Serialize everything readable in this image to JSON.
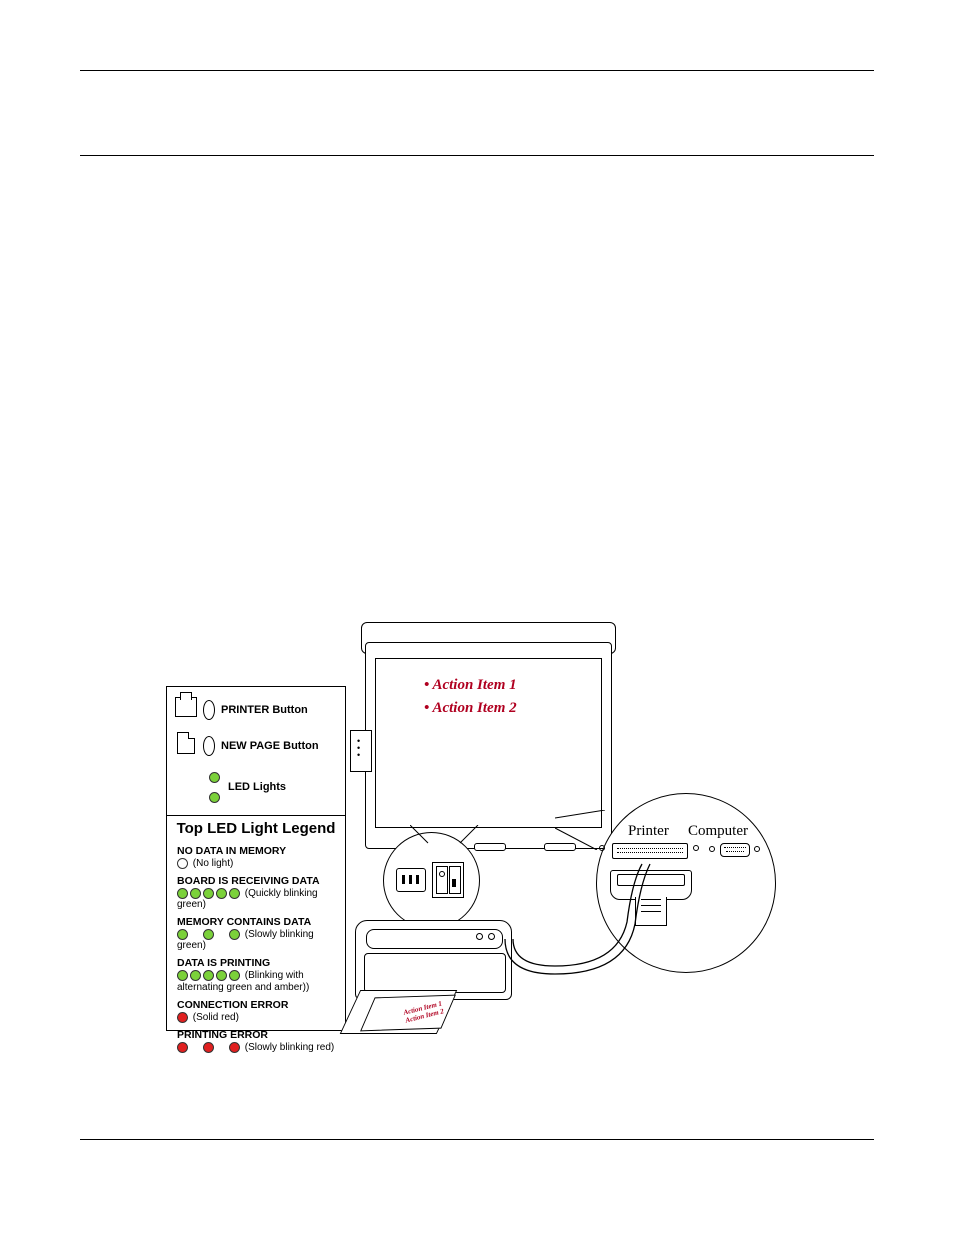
{
  "legend": {
    "printer_button": "PRINTER Button",
    "newpage_button": "NEW PAGE Button",
    "led_lights": "LED Lights",
    "title": "Top LED Light Legend",
    "states": [
      {
        "name": "NO DATA IN MEMORY",
        "dots": [
          "off"
        ],
        "note": "(No light)"
      },
      {
        "name": "BOARD IS RECEIVING DATA",
        "dots": [
          "green",
          "green",
          "green",
          "green",
          "green"
        ],
        "note": "(Quickly blinking green)"
      },
      {
        "name": "MEMORY CONTAINS DATA",
        "dots": [
          "green",
          "off",
          "green",
          "off",
          "green"
        ],
        "note": "(Slowly blinking green)"
      },
      {
        "name": "DATA IS PRINTING",
        "dots": [
          "green",
          "green",
          "green",
          "green",
          "green"
        ],
        "note": "(Blinking with alternating green and amber))"
      },
      {
        "name": "CONNECTION ERROR",
        "dots": [
          "red"
        ],
        "note": "(Solid red)"
      },
      {
        "name": "PRINTING ERROR",
        "dots": [
          "red",
          "off",
          "red",
          "off",
          "red"
        ],
        "note": "(Slowly blinking red)"
      }
    ]
  },
  "board": {
    "item1": "• Action Item 1",
    "item2": "• Action Item 2"
  },
  "connectors": {
    "printer": "Printer",
    "computer": "Computer"
  },
  "printout": {
    "line1": "Action Item 1",
    "line2": "Action Item 2"
  }
}
